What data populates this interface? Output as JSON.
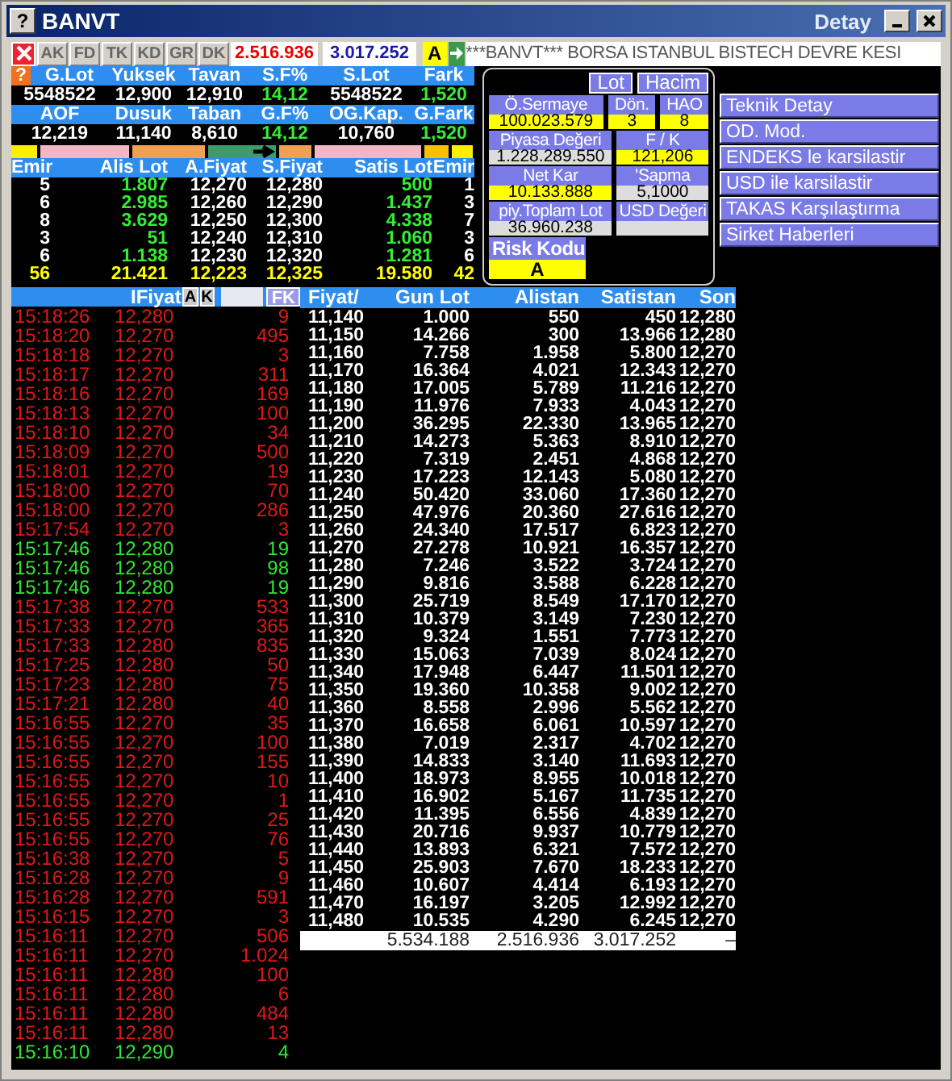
{
  "window": {
    "help": "?",
    "title": "BANVT",
    "subtitle": "Detay"
  },
  "toolbar": {
    "tabs": [
      {
        "label": "AK",
        "disabled": true
      },
      {
        "label": "FD",
        "disabled": true
      },
      {
        "label": "TK",
        "disabled": true
      },
      {
        "label": "KD",
        "disabled": true
      },
      {
        "label": "GR",
        "disabled": true
      },
      {
        "label": "DK",
        "disabled": true
      }
    ],
    "sell_volume": "2.516.936",
    "buy_volume": "3.017.252",
    "risk": "A",
    "ticker": "***BANVT*** BORSA ISTANBUL BISTECH DEVRE KESI"
  },
  "summary": {
    "help": "?",
    "rows": [
      {
        "labels": [
          "G.Lot",
          "Yuksek",
          "Tavan",
          "S.F%",
          "S.Lot",
          "Fark"
        ],
        "values": [
          {
            "text": "5548522",
            "kind": "plain"
          },
          {
            "text": "12,900",
            "kind": "plain"
          },
          {
            "text": "12,910",
            "kind": "plain"
          },
          {
            "text": "14,12",
            "kind": "up"
          },
          {
            "text": "5548522",
            "kind": "plain"
          },
          {
            "text": "1,520",
            "kind": "up"
          }
        ]
      },
      {
        "labels": [
          "AOF",
          "Dusuk",
          "Taban",
          "G.F%",
          "OG.Kap.",
          "G.Fark"
        ],
        "values": [
          {
            "text": "12,219",
            "kind": "plain"
          },
          {
            "text": "11,140",
            "kind": "plain"
          },
          {
            "text": "8,610",
            "kind": "plain"
          },
          {
            "text": "14,12",
            "kind": "up"
          },
          {
            "text": "10,760",
            "kind": "plain"
          },
          {
            "text": "1,520",
            "kind": "up"
          }
        ]
      }
    ]
  },
  "depth": {
    "columns": [
      "Emir",
      "Alis Lot",
      "A.Fiyat",
      "S.Fiyat",
      "Satis Lot",
      "Emir"
    ],
    "rows": [
      [
        "5",
        "1.807",
        "12,270",
        "12,280",
        "500",
        "1"
      ],
      [
        "6",
        "2.985",
        "12,260",
        "12,290",
        "1.437",
        "3"
      ],
      [
        "8",
        "3.629",
        "12,250",
        "12,300",
        "4.338",
        "7"
      ],
      [
        "3",
        "51",
        "12,240",
        "12,310",
        "1.060",
        "3"
      ],
      [
        "6",
        "1.138",
        "12,230",
        "12,320",
        "1.281",
        "6"
      ]
    ],
    "totals": [
      "56",
      "21.421",
      "12,223",
      "12,325",
      "19.580",
      "42"
    ]
  },
  "panel": {
    "toggles": [
      "Lot",
      "Hacim"
    ],
    "rows": [
      [
        {
          "label": "Ö.Sermaye",
          "value": "100.023.579",
          "kind": "highlight"
        },
        {
          "label": "Dön.",
          "value": "3",
          "kind": "highlight"
        },
        {
          "label": "HAO",
          "value": "8",
          "kind": "highlight"
        }
      ],
      [
        {
          "label": "Piyasa Değeri",
          "value": "1.228.289.550",
          "kind": "plain"
        },
        {
          "label": "F / K",
          "value": "121,206",
          "kind": "highlight"
        }
      ],
      [
        {
          "label": "Net Kar",
          "value": "10.133.888",
          "kind": "highlight"
        },
        {
          "label": "'Sapma",
          "value": "5,1000",
          "kind": "plain"
        }
      ],
      [
        {
          "label": "piy.Toplam Lot",
          "value": "36.960.238",
          "kind": "plain"
        },
        {
          "label": "USD Değeri",
          "kind": "plain"
        }
      ],
      [
        {
          "label": "Risk Kodu",
          "value": "A",
          "kind": "highlight"
        }
      ]
    ]
  },
  "actions": [
    "Teknik Detay",
    "OD. Mod.",
    "ENDEKS le karsilastir",
    "USD ile karsilastir",
    "TAKAS Karşılaştırma",
    "Sirket Haberleri"
  ],
  "trades": {
    "header": "IFiyat",
    "buttons": [
      "A",
      "K"
    ],
    "fk": "FK",
    "rows": [
      {
        "time": "15:18:26",
        "price": "12,280",
        "lot": "9",
        "kind": "down"
      },
      {
        "time": "15:18:20",
        "price": "12,270",
        "lot": "495",
        "kind": "down"
      },
      {
        "time": "15:18:18",
        "price": "12,270",
        "lot": "3",
        "kind": "down"
      },
      {
        "time": "15:18:17",
        "price": "12,270",
        "lot": "311",
        "kind": "down"
      },
      {
        "time": "15:18:16",
        "price": "12,270",
        "lot": "169",
        "kind": "down"
      },
      {
        "time": "15:18:13",
        "price": "12,270",
        "lot": "100",
        "kind": "down"
      },
      {
        "time": "15:18:10",
        "price": "12,270",
        "lot": "34",
        "kind": "down"
      },
      {
        "time": "15:18:09",
        "price": "12,270",
        "lot": "500",
        "kind": "down"
      },
      {
        "time": "15:18:01",
        "price": "12,270",
        "lot": "19",
        "kind": "down"
      },
      {
        "time": "15:18:00",
        "price": "12,270",
        "lot": "70",
        "kind": "down"
      },
      {
        "time": "15:18:00",
        "price": "12,270",
        "lot": "286",
        "kind": "down"
      },
      {
        "time": "15:17:54",
        "price": "12,270",
        "lot": "3",
        "kind": "down"
      },
      {
        "time": "15:17:46",
        "price": "12,280",
        "lot": "19",
        "kind": "up"
      },
      {
        "time": "15:17:46",
        "price": "12,280",
        "lot": "98",
        "kind": "up"
      },
      {
        "time": "15:17:46",
        "price": "12,280",
        "lot": "19",
        "kind": "up"
      },
      {
        "time": "15:17:38",
        "price": "12,270",
        "lot": "533",
        "kind": "down"
      },
      {
        "time": "15:17:33",
        "price": "12,270",
        "lot": "365",
        "kind": "down"
      },
      {
        "time": "15:17:33",
        "price": "12,280",
        "lot": "835",
        "kind": "down"
      },
      {
        "time": "15:17:25",
        "price": "12,280",
        "lot": "50",
        "kind": "down"
      },
      {
        "time": "15:17:23",
        "price": "12,280",
        "lot": "75",
        "kind": "down"
      },
      {
        "time": "15:17:21",
        "price": "12,280",
        "lot": "40",
        "kind": "down"
      },
      {
        "time": "15:16:55",
        "price": "12,270",
        "lot": "35",
        "kind": "down"
      },
      {
        "time": "15:16:55",
        "price": "12,270",
        "lot": "100",
        "kind": "down"
      },
      {
        "time": "15:16:55",
        "price": "12,270",
        "lot": "155",
        "kind": "down"
      },
      {
        "time": "15:16:55",
        "price": "12,270",
        "lot": "10",
        "kind": "down"
      },
      {
        "time": "15:16:55",
        "price": "12,270",
        "lot": "1",
        "kind": "down"
      },
      {
        "time": "15:16:55",
        "price": "12,270",
        "lot": "25",
        "kind": "down"
      },
      {
        "time": "15:16:55",
        "price": "12,270",
        "lot": "76",
        "kind": "down"
      },
      {
        "time": "15:16:38",
        "price": "12,270",
        "lot": "5",
        "kind": "down"
      },
      {
        "time": "15:16:28",
        "price": "12,270",
        "lot": "9",
        "kind": "down"
      },
      {
        "time": "15:16:28",
        "price": "12,270",
        "lot": "591",
        "kind": "down"
      },
      {
        "time": "15:16:15",
        "price": "12,270",
        "lot": "3",
        "kind": "down"
      },
      {
        "time": "15:16:11",
        "price": "12,270",
        "lot": "506",
        "kind": "down"
      },
      {
        "time": "15:16:11",
        "price": "12,270",
        "lot": "1.024",
        "kind": "down"
      },
      {
        "time": "15:16:11",
        "price": "12,280",
        "lot": "100",
        "kind": "down"
      },
      {
        "time": "15:16:11",
        "price": "12,280",
        "lot": "6",
        "kind": "down"
      },
      {
        "time": "15:16:11",
        "price": "12,280",
        "lot": "484",
        "kind": "down"
      },
      {
        "time": "15:16:11",
        "price": "12,280",
        "lot": "13",
        "kind": "down"
      },
      {
        "time": "15:16:10",
        "price": "12,290",
        "lot": "4",
        "kind": "up"
      }
    ]
  },
  "prices": {
    "columns": [
      "Fiyat/",
      "Gun Lot",
      "Alistan",
      "Satistan",
      "Son"
    ],
    "rows": [
      [
        "11,140",
        "1.000",
        "550",
        "450",
        "12,280"
      ],
      [
        "11,150",
        "14.266",
        "300",
        "13.966",
        "12,280"
      ],
      [
        "11,160",
        "7.758",
        "1.958",
        "5.800",
        "12,270"
      ],
      [
        "11,170",
        "16.364",
        "4.021",
        "12.343",
        "12,270"
      ],
      [
        "11,180",
        "17.005",
        "5.789",
        "11.216",
        "12,270"
      ],
      [
        "11,190",
        "11.976",
        "7.933",
        "4.043",
        "12,270"
      ],
      [
        "11,200",
        "36.295",
        "22.330",
        "13.965",
        "12,270"
      ],
      [
        "11,210",
        "14.273",
        "5.363",
        "8.910",
        "12,270"
      ],
      [
        "11,220",
        "7.319",
        "2.451",
        "4.868",
        "12,270"
      ],
      [
        "11,230",
        "17.223",
        "12.143",
        "5.080",
        "12,270"
      ],
      [
        "11,240",
        "50.420",
        "33.060",
        "17.360",
        "12,270"
      ],
      [
        "11,250",
        "47.976",
        "20.360",
        "27.616",
        "12,270"
      ],
      [
        "11,260",
        "24.340",
        "17.517",
        "6.823",
        "12,270"
      ],
      [
        "11,270",
        "27.278",
        "10.921",
        "16.357",
        "12,270"
      ],
      [
        "11,280",
        "7.246",
        "3.522",
        "3.724",
        "12,270"
      ],
      [
        "11,290",
        "9.816",
        "3.588",
        "6.228",
        "12,270"
      ],
      [
        "11,300",
        "25.719",
        "8.549",
        "17.170",
        "12,270"
      ],
      [
        "11,310",
        "10.379",
        "3.149",
        "7.230",
        "12,270"
      ],
      [
        "11,320",
        "9.324",
        "1.551",
        "7.773",
        "12,270"
      ],
      [
        "11,330",
        "15.063",
        "7.039",
        "8.024",
        "12,270"
      ],
      [
        "11,340",
        "17.948",
        "6.447",
        "11.501",
        "12,270"
      ],
      [
        "11,350",
        "19.360",
        "10.358",
        "9.002",
        "12,270"
      ],
      [
        "11,360",
        "8.558",
        "2.996",
        "5.562",
        "12,270"
      ],
      [
        "11,370",
        "16.658",
        "6.061",
        "10.597",
        "12,270"
      ],
      [
        "11,380",
        "7.019",
        "2.317",
        "4.702",
        "12,270"
      ],
      [
        "11,390",
        "14.833",
        "3.140",
        "11.693",
        "12,270"
      ],
      [
        "11,400",
        "18.973",
        "8.955",
        "10.018",
        "12,270"
      ],
      [
        "11,410",
        "16.902",
        "5.167",
        "11.735",
        "12,270"
      ],
      [
        "11,420",
        "11.395",
        "6.556",
        "4.839",
        "12,270"
      ],
      [
        "11,430",
        "20.716",
        "9.937",
        "10.779",
        "12,270"
      ],
      [
        "11,440",
        "13.893",
        "6.321",
        "7.572",
        "12,270"
      ],
      [
        "11,450",
        "25.903",
        "7.670",
        "18.233",
        "12,270"
      ],
      [
        "11,460",
        "10.607",
        "4.414",
        "6.193",
        "12,270"
      ],
      [
        "11,470",
        "16.197",
        "3.205",
        "12.992",
        "12,270"
      ],
      [
        "11,480",
        "10.535",
        "4.290",
        "6.245",
        "12,270"
      ]
    ],
    "totals": [
      "5.534.188",
      "2.516.936",
      "3.017.252",
      "–"
    ]
  }
}
